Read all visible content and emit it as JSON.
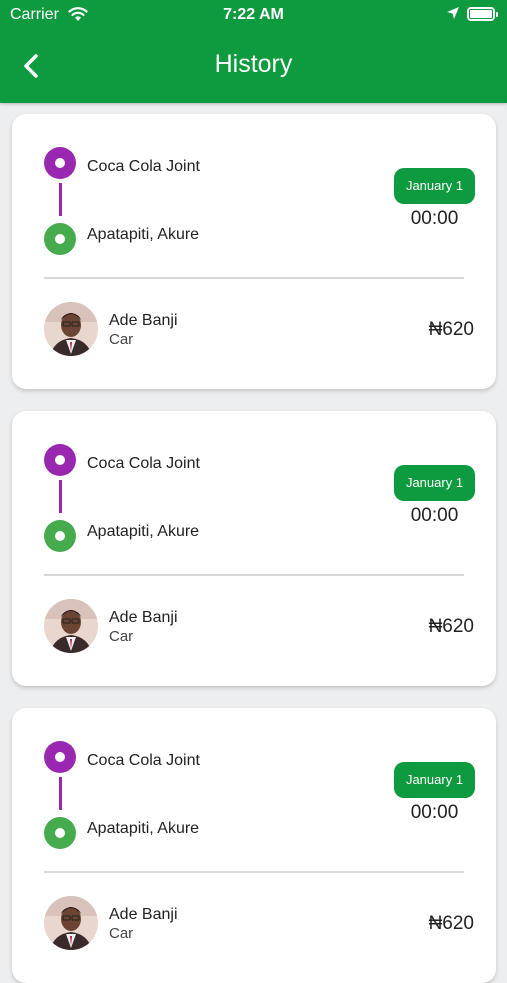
{
  "status_bar": {
    "carrier": "Carrier",
    "time": "7:22 AM"
  },
  "header": {
    "title": "History"
  },
  "colors": {
    "brand": "#0e9a3f",
    "pickup": "#9a27b0",
    "dropoff": "#45ab4d"
  },
  "trips": [
    {
      "from": "Coca Cola Joint",
      "to": "Apatapiti, Akure",
      "date": "January 1",
      "time": "00:00",
      "driver": "Ade Banji",
      "vehicle": "Car",
      "price": "₦620"
    },
    {
      "from": "Coca Cola Joint",
      "to": "Apatapiti, Akure",
      "date": "January 1",
      "time": "00:00",
      "driver": "Ade Banji",
      "vehicle": "Car",
      "price": "₦620"
    },
    {
      "from": "Coca Cola Joint",
      "to": "Apatapiti, Akure",
      "date": "January 1",
      "time": "00:00",
      "driver": "Ade Banji",
      "vehicle": "Car",
      "price": "₦620"
    }
  ]
}
